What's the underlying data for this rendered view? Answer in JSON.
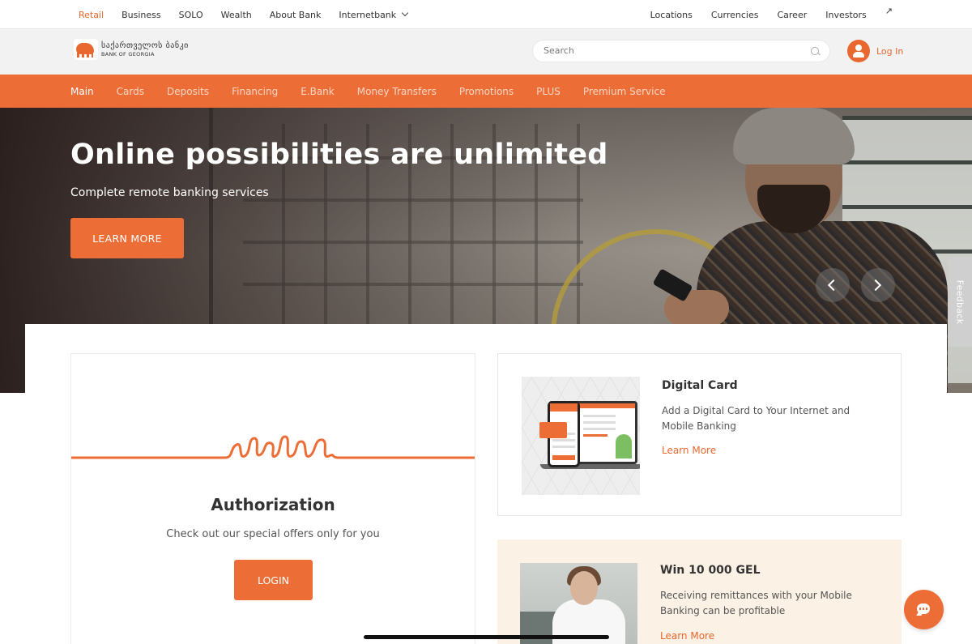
{
  "topbar": {
    "segments": [
      "Retail",
      "Business",
      "SOLO",
      "Wealth",
      "About Bank",
      "Internetbank"
    ],
    "right_links": [
      "Locations",
      "Currencies",
      "Career",
      "Investors"
    ]
  },
  "header": {
    "logo_georgian": "საქართველოს ბანკი",
    "logo_english": "BANK OF GEORGIA",
    "search_placeholder": "Search",
    "login_label": "Log In"
  },
  "nav": {
    "items": [
      "Main",
      "Cards",
      "Deposits",
      "Financing",
      "E.Bank",
      "Money Transfers",
      "Promotions",
      "PLUS",
      "Premium Service"
    ],
    "active": "Main"
  },
  "hero": {
    "title": "Online possibilities are unlimited",
    "subtitle": "Complete remote banking services",
    "cta_label": "LEARN MORE"
  },
  "feedback_label": "Feedback",
  "auth": {
    "title": "Authorization",
    "description": "Check out our special offers only for you",
    "button_label": "LOGIN"
  },
  "cards": [
    {
      "title": "Digital Card",
      "description": "Add a Digital Card to Your Internet and Mobile Banking",
      "link": "Learn More"
    },
    {
      "title": "Win 10 000 GEL",
      "description": "Receiving remittances with your Mobile Banking can be profitable",
      "link": "Learn More"
    }
  ],
  "colors": {
    "accent": "#ec6d36",
    "nav_inactive": "#fbd6c4",
    "promo_bg": "#fcf1e5"
  },
  "icons": {
    "search": "search-icon",
    "user": "user-icon",
    "chat": "chat-icon",
    "external": "external-link-icon",
    "dropdown": "chevron-down-icon",
    "prev": "chevron-left-icon",
    "next": "chevron-right-icon"
  }
}
